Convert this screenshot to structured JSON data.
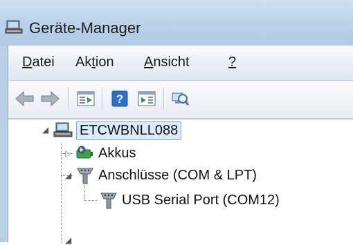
{
  "window": {
    "title": "Geräte-Manager"
  },
  "menu": {
    "file": {
      "mnemonic": "D",
      "rest": "atei"
    },
    "action": {
      "pre": "Ak",
      "mnemonic": "t",
      "rest": "ion"
    },
    "view": {
      "mnemonic": "A",
      "rest": "nsicht"
    },
    "help": {
      "mnemonic": "?"
    }
  },
  "toolbar": {
    "buttons": [
      "back-icon",
      "forward-icon",
      "properties-view-icon",
      "help-icon",
      "console-tree-icon",
      "scan-hardware-icon"
    ]
  },
  "tree": {
    "root": "ETCWBNLL088",
    "items": [
      {
        "label": "Akkus",
        "expander": "collapsed"
      },
      {
        "label": "Anschlüsse (COM & LPT)",
        "expander": "expanded"
      },
      {
        "label": "USB Serial Port (COM12)"
      }
    ]
  },
  "colors": {
    "titlebar": "#bcd3ea",
    "selection": "#dcebfc",
    "selection_border": "#7da2ce"
  }
}
